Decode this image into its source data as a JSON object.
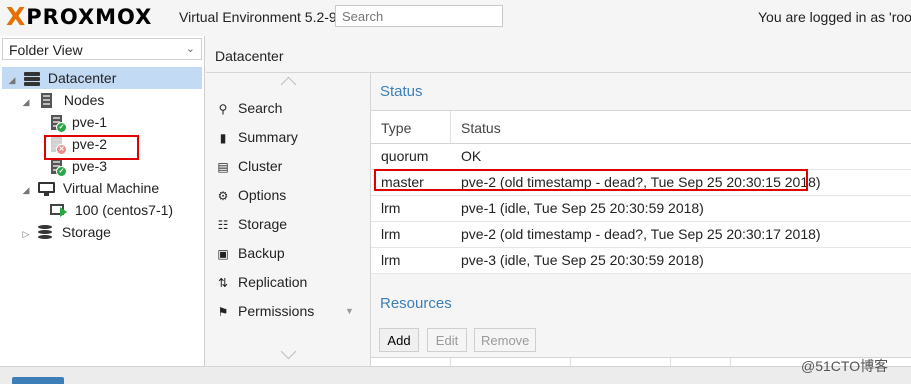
{
  "header": {
    "logo_text": "PROXMOX",
    "logo_mark": "X",
    "version": "Virtual Environment 5.2-9",
    "search_placeholder": "Search",
    "logged_in": "You are logged in as 'root@"
  },
  "sidebar": {
    "view_selector": "Folder View",
    "tree": {
      "datacenter": "Datacenter",
      "nodes": "Nodes",
      "node_items": [
        "pve-1",
        "pve-2",
        "pve-3"
      ],
      "virtual_machine": "Virtual Machine",
      "vm_items": [
        "100 (centos7-1)"
      ],
      "storage": "Storage"
    }
  },
  "main": {
    "title": "Datacenter",
    "menu": [
      {
        "label": "Search",
        "icon": "search-icon"
      },
      {
        "label": "Summary",
        "icon": "book-icon"
      },
      {
        "label": "Cluster",
        "icon": "server-icon"
      },
      {
        "label": "Options",
        "icon": "gear-icon"
      },
      {
        "label": "Storage",
        "icon": "database-icon"
      },
      {
        "label": "Backup",
        "icon": "floppy-icon"
      },
      {
        "label": "Replication",
        "icon": "retweet-icon"
      },
      {
        "label": "Permissions",
        "icon": "unlock-icon"
      }
    ],
    "status": {
      "title": "Status",
      "columns": [
        "Type",
        "Status"
      ],
      "rows": [
        {
          "type": "quorum",
          "status": "OK"
        },
        {
          "type": "master",
          "status": "pve-2 (old timestamp - dead?, Tue Sep 25 20:30:15 2018)"
        },
        {
          "type": "lrm",
          "status": "pve-1 (idle, Tue Sep 25 20:30:59 2018)"
        },
        {
          "type": "lrm",
          "status": "pve-2 (old timestamp - dead?, Tue Sep 25 20:30:17 2018)"
        },
        {
          "type": "lrm",
          "status": "pve-3 (idle, Tue Sep 25 20:30:59 2018)"
        }
      ]
    },
    "resources": {
      "title": "Resources",
      "buttons": {
        "add": "Add",
        "edit": "Edit",
        "remove": "Remove"
      }
    }
  },
  "watermark": "@51CTO博客",
  "colors": {
    "accent": "#3c7fb8",
    "brand": "#e57000",
    "highlight": "#e00000",
    "ok": "#2aa745",
    "error": "#d9302c"
  }
}
